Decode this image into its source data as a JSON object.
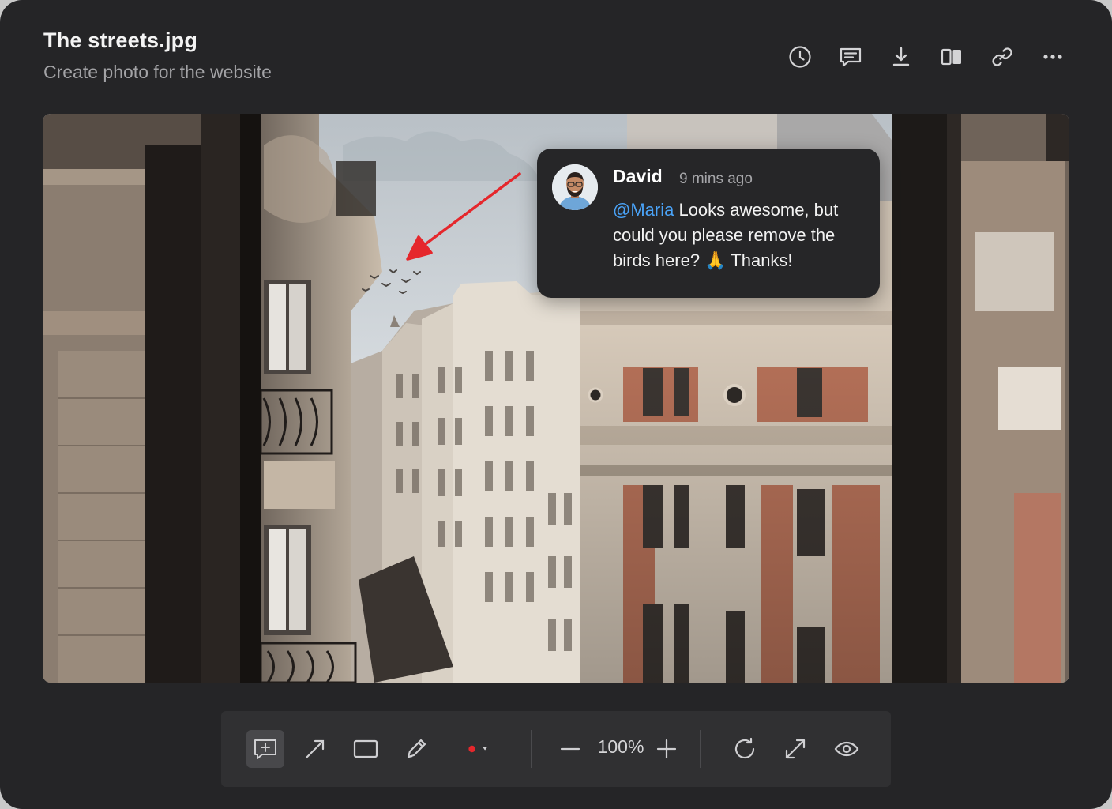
{
  "header": {
    "title": "The streets.jpg",
    "subtitle": "Create photo for the website",
    "actions": [
      {
        "name": "history-icon"
      },
      {
        "name": "comments-icon"
      },
      {
        "name": "download-icon"
      },
      {
        "name": "compare-icon"
      },
      {
        "name": "link-icon"
      },
      {
        "name": "more-icon"
      }
    ]
  },
  "comment": {
    "author": "David",
    "time": "9 mins ago",
    "mention": "@Maria",
    "text": " Looks awesome, but could you please remove the birds here? 🙏 Thanks!"
  },
  "toolbar": {
    "tools": [
      "add-comment-icon",
      "arrow-icon",
      "rectangle-icon",
      "pencil-icon"
    ],
    "color": "#e5272c",
    "zoom": "100%",
    "right_tools": [
      "rotate-icon",
      "fullscreen-icon",
      "preview-eye-icon"
    ]
  },
  "colors": {
    "background": "#252527",
    "accent_mention": "#4aa3f8",
    "annotation_arrow": "#e5272c"
  }
}
